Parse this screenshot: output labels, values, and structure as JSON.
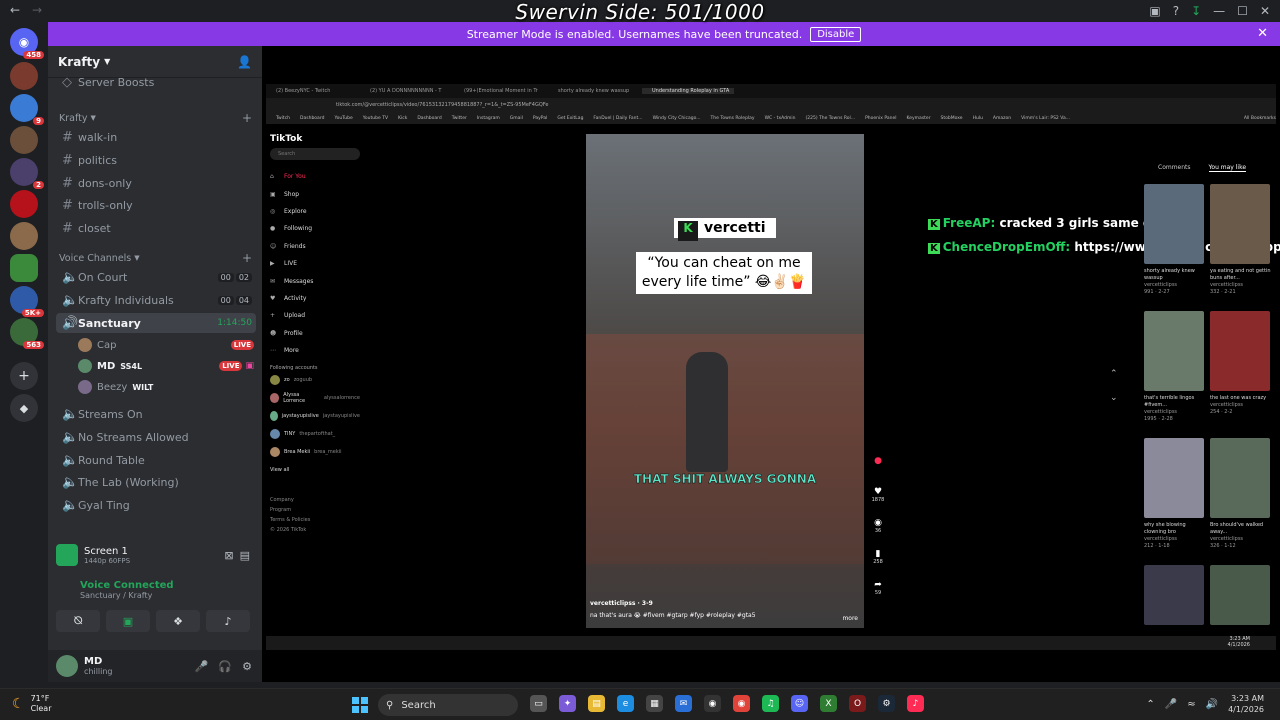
{
  "window": {
    "overlay_title": "Swervin Side: 501/1000"
  },
  "streamer_bar": {
    "message": "Streamer Mode is enabled. Usernames have been truncated.",
    "disable_label": "Disable"
  },
  "rail": {
    "badges": [
      "458",
      "9",
      "2",
      "5K+",
      "563"
    ]
  },
  "sidebar": {
    "server_name": "Krafty",
    "partial_item": "Server Boosts",
    "category_text": "Krafty",
    "text_channels": [
      "walk-in",
      "politics",
      "dons-only",
      "trolls-only",
      "closet"
    ],
    "voice_category": "Voice Channels",
    "voice_channels": [
      {
        "name": "On Court",
        "count_a": "00",
        "count_b": "02"
      },
      {
        "name": "Krafty Individuals",
        "count_a": "00",
        "count_b": "04"
      }
    ],
    "active_channel": {
      "name": "Sanctuary",
      "time": "1:14:50"
    },
    "users": [
      {
        "name": "Cap",
        "badge": "LIVE"
      },
      {
        "name": "MD",
        "tag": "SS4L",
        "badge": "LIVE"
      },
      {
        "name": "Beezy",
        "tag": "WILT"
      }
    ],
    "more_voice": [
      "Streams On",
      "No Streams Allowed",
      "Round Table",
      "The Lab (Working)",
      "Gyal Ting"
    ]
  },
  "screen_panel": {
    "title": "Screen 1",
    "quality": "1440p 60FPS",
    "status": "Voice Connected",
    "location": "Sanctuary / Krafty"
  },
  "user_panel": {
    "name": "MD",
    "status": "chilling"
  },
  "stream": {
    "tabs": [
      "(2) BeezyNYC - Twitch",
      "(2) YU A DONNNNNNNNN - T",
      "(99+)Emotional Moment in Tr",
      "shorty already knew wassup",
      "Understanding Roleplay in GTA"
    ],
    "address": "tiktok.com/@vercetticlipss/video/7615313217945881887?_r=1&_t=ZS-95MeF4GQFe",
    "bookmarks": [
      "Twitch",
      "Dashboard",
      "YouTube",
      "Youtube TV",
      "Kick",
      "Dashboard",
      "Twitter",
      "Instagram",
      "Gmail",
      "PayPal",
      "Get ExitLag",
      "FanDuel | Daily Fant...",
      "Windy City Chicago...",
      "The Towns Roleplay",
      "WC - txAdmin",
      "(225) The Towns Rol...",
      "Phoenix Panel",
      "Keymaster",
      "StobMoxe",
      "Hulu",
      "Amazon",
      "Vimm's Lair: PS2 Va...",
      "All Bookmarks"
    ],
    "tiktok": {
      "logo": "TikTok",
      "search_placeholder": "Search",
      "nav": [
        "For You",
        "Shop",
        "Explore",
        "Following",
        "Friends",
        "LIVE",
        "Messages",
        "Activity",
        "Upload",
        "Profile",
        "More"
      ],
      "following_title": "Following accounts",
      "following": [
        {
          "name": "zo",
          "handle": "zoguub"
        },
        {
          "name": "Alyssa Lorrence",
          "handle": "alyssalorrence"
        },
        {
          "name": "jaystayupislive",
          "handle": "jaystayupislive"
        },
        {
          "name": "TINY",
          "handle": "thepartofthat_"
        },
        {
          "name": "Brea Mekii",
          "handle": "brea_mekii"
        }
      ],
      "view_all": "View all",
      "footer": [
        "Company",
        "Program",
        "Terms & Policies",
        "© 2026 TikTok"
      ]
    },
    "video": {
      "label": "vercetti",
      "quote": "“You can cheat on me every life time” 😂✌🏻🍟",
      "caption": "THAT SHIT ALWAYS GONNA",
      "author": "vercetticlipss · 3-9",
      "desc": "na that's aura 😭 #fivem #gtarp #fyp #roleplay #gta5",
      "more": "more"
    },
    "actions": [
      "1878",
      "36",
      "258",
      "59"
    ],
    "chat": [
      {
        "name": "FreeAP:",
        "text": "cracked 3 girls same day"
      },
      {
        "name": "ChenceDropEmOff:",
        "text": "https://www.tiktok.com/@capptv/vid"
      }
    ],
    "right_panel": {
      "tabs": [
        "Comments",
        "You may like"
      ],
      "thumbs": [
        {
          "caption": "shorty already knew wassup",
          "author": "vercetticlipss",
          "stats": "991 · 2-27"
        },
        {
          "caption": "ya eating and not gettin buns after...",
          "author": "vercetticlipss",
          "stats": "332 · 2-21"
        },
        {
          "caption": "that's terrible lingos #fivem...",
          "author": "vercetticlipss",
          "stats": "1995 · 2-28"
        },
        {
          "caption": "the last one was crazy",
          "author": "vercetticlipss",
          "stats": "254 · 2-2"
        },
        {
          "caption": "why she blowing clowning bro",
          "author": "vercetticlipss",
          "stats": "212 · 1-18"
        },
        {
          "caption": "Bro should've walked away...",
          "author": "vercetticlipss",
          "stats": "326 · 1-12"
        }
      ]
    },
    "mini_clock": {
      "time": "3:23 AM",
      "date": "4/1/2026"
    }
  },
  "taskbar": {
    "weather_temp": "71°F",
    "weather_desc": "Clear",
    "search_label": "Search",
    "time": "3:23 AM",
    "date": "4/1/2026"
  }
}
